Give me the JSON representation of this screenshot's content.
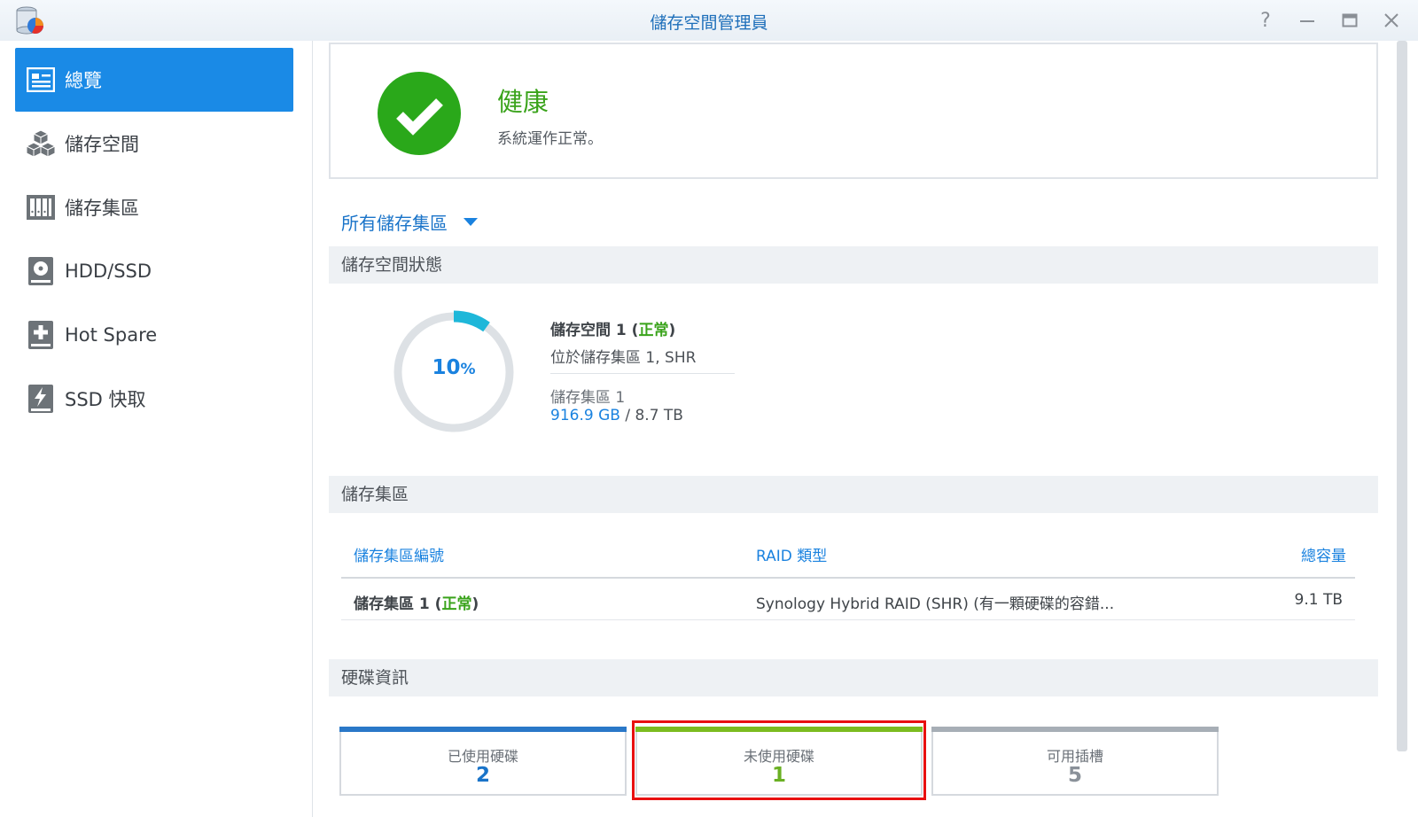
{
  "window": {
    "title": "儲存空間管理員",
    "controls": [
      "help-icon",
      "minimize-icon",
      "maximize-icon",
      "close-icon"
    ]
  },
  "sidebar": {
    "items": [
      {
        "label": "總覽",
        "icon": "overview-icon",
        "active": true
      },
      {
        "label": "儲存空間",
        "icon": "volume-icon",
        "active": false
      },
      {
        "label": "儲存集區",
        "icon": "storage-pool-icon",
        "active": false
      },
      {
        "label": "HDD/SSD",
        "icon": "hdd-icon",
        "active": false
      },
      {
        "label": "Hot Spare",
        "icon": "hot-spare-icon",
        "active": false
      },
      {
        "label": "SSD 快取",
        "icon": "ssd-cache-icon",
        "active": false
      }
    ]
  },
  "health": {
    "title": "健康",
    "description": "系統運作正常。",
    "icon": "check-circle-icon",
    "color": "#2aa81a"
  },
  "pool_selector": {
    "label": "所有儲存集區"
  },
  "volume_status": {
    "heading": "儲存空間狀態",
    "usage_percent": 10,
    "usage_number": "10",
    "usage_unit": "%",
    "volume_name": "儲存空間 1",
    "volume_state": "正常",
    "location": "位於儲存集區 1, SHR",
    "pool": "儲存集區 1",
    "used": "916.9 GB",
    "separator": " / ",
    "total": "8.7 TB"
  },
  "storage_pool": {
    "heading": "儲存集區",
    "columns": [
      "儲存集區編號",
      "RAID 類型",
      "總容量"
    ],
    "rows": [
      {
        "name": "儲存集區 1",
        "state": "正常",
        "raid": "Synology Hybrid RAID (SHR) (有一顆硬碟的容錯...",
        "capacity": "9.1 TB"
      }
    ]
  },
  "disk_info": {
    "heading": "硬碟資訊",
    "cards": [
      {
        "label": "已使用硬碟",
        "value": "2",
        "color": "#1a74c9"
      },
      {
        "label": "未使用硬碟",
        "value": "1",
        "color": "#6ab023",
        "highlighted": true
      },
      {
        "label": "可用插槽",
        "value": "5",
        "color": "#8a9199"
      }
    ]
  }
}
